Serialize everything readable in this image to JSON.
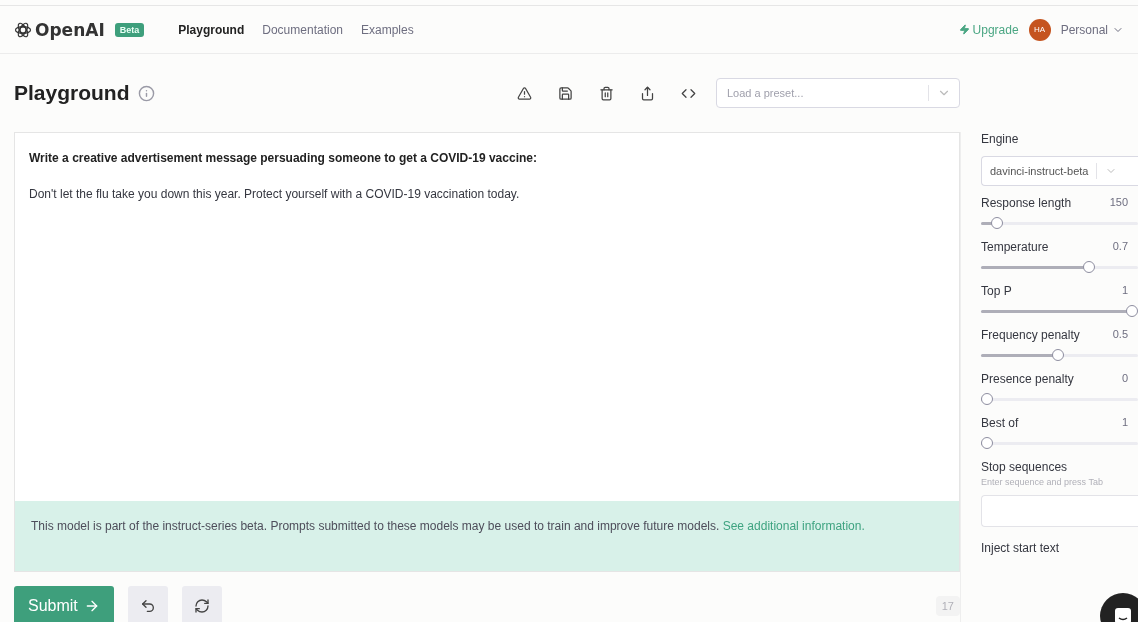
{
  "header": {
    "brand": "OpenAI",
    "badge": "Beta",
    "nav": [
      {
        "label": "Playground",
        "selected": true
      },
      {
        "label": "Documentation",
        "selected": false
      },
      {
        "label": "Examples",
        "selected": false
      }
    ],
    "upgrade": "Upgrade",
    "avatar": "HA",
    "account": "Personal"
  },
  "title": "Playground",
  "preset": {
    "placeholder": "Load a preset..."
  },
  "editor": {
    "prompt": "Write a creative advertisement message persuading someone to get a COVID-19 vaccine:",
    "completion": "Don't let the flu take you down this year. Protect yourself with a COVID-19 vaccination today."
  },
  "notice": {
    "text": "This model is part of the instruct-series beta. Prompts submitted to these models may be used to train and improve future models.",
    "link": "See additional information."
  },
  "actions": {
    "submit": "Submit",
    "token_count": "17"
  },
  "settings": {
    "engine_label": "Engine",
    "engine": "davinci-instruct-beta",
    "sliders": [
      {
        "label": "Response length",
        "reading": "150",
        "level": 0.07
      },
      {
        "label": "Temperature",
        "reading": "0.7",
        "level": 0.7
      },
      {
        "label": "Top P",
        "reading": "1",
        "level": 1
      },
      {
        "label": "Frequency penalty",
        "reading": "0.5",
        "level": 0.49
      },
      {
        "label": "Presence penalty",
        "reading": "0",
        "level": 0
      },
      {
        "label": "Best of",
        "reading": "1",
        "level": 0
      }
    ],
    "stop_label": "Stop sequences",
    "stop_hint": "Enter sequence and press Tab",
    "inject_label": "Inject start text"
  }
}
